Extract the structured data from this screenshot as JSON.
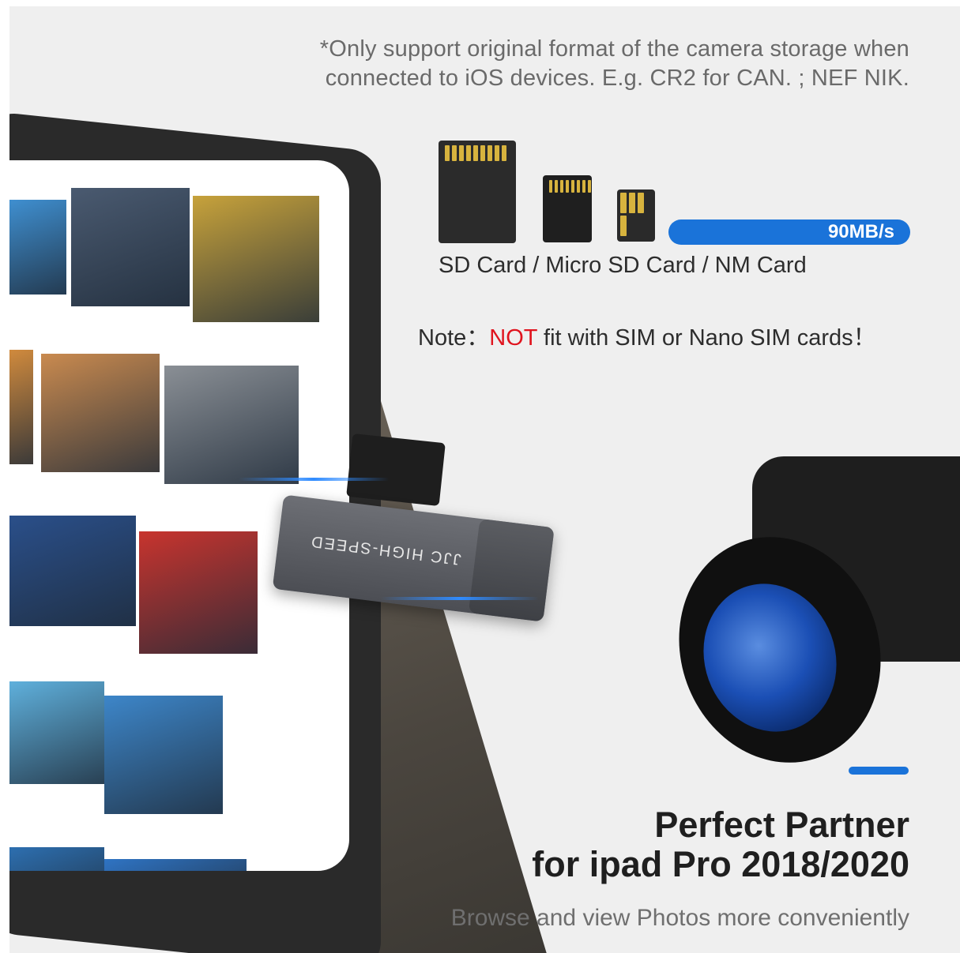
{
  "footnote": {
    "line1": "*Only support original format of the camera storage when",
    "line2": "connected to iOS devices. E.g. CR2 for CAN. ; NEF NIK."
  },
  "speed_bar": {
    "label": "90MB/s",
    "color": "#1a73d9"
  },
  "card_types": "SD Card / Micro SD Card / NM Card",
  "note": {
    "prefix": "Note：",
    "warning": "NOT",
    "suffix": " fit with SIM or Nano SIM cards！",
    "warning_color": "#e0141e"
  },
  "reader": {
    "label": "JJC HIGH-SPEED"
  },
  "headline": {
    "line1": "Perfect Partner",
    "line2": "for ipad Pro 2018/2020"
  },
  "subline": "Browse and view Photos more conveniently",
  "photos": [
    {
      "name": "photo-sea-boat",
      "color": "#3f8fd0"
    },
    {
      "name": "photo-rocky-coast",
      "color": "#4a5a70"
    },
    {
      "name": "photo-sunset-flowers",
      "color": "#c7a23b"
    },
    {
      "name": "photo-food-partial",
      "color": "#d08a3d"
    },
    {
      "name": "photo-breakfast",
      "color": "#c98a4f"
    },
    {
      "name": "photo-waterfall",
      "color": "#8a8f95"
    },
    {
      "name": "photo-city-night",
      "color": "#2a4f8a"
    },
    {
      "name": "photo-red-phonebooth",
      "color": "#c8342e"
    },
    {
      "name": "photo-beach",
      "color": "#5fb0dc"
    },
    {
      "name": "photo-mountain-lake",
      "color": "#3d86c9"
    },
    {
      "name": "photo-partial-blue",
      "color": "#2d6fb0"
    },
    {
      "name": "photo-partial-sky",
      "color": "#2f74c4"
    }
  ]
}
